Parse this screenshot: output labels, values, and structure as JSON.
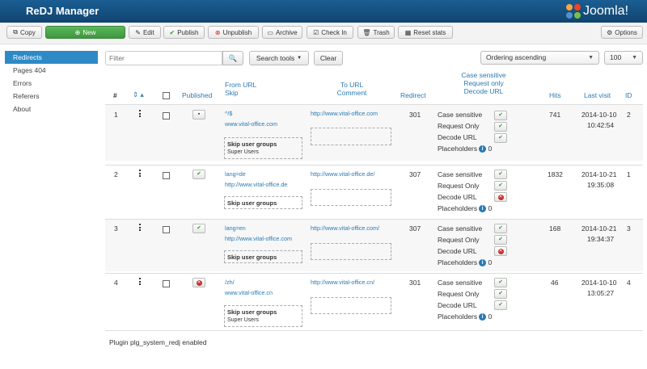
{
  "app": {
    "title": "ReDJ Manager",
    "logo_text": "Joomla!"
  },
  "toolbar": {
    "copy": "Copy",
    "new": "New",
    "edit": "Edit",
    "publish": "Publish",
    "unpublish": "Unpublish",
    "archive": "Archive",
    "check_in": "Check In",
    "trash": "Trash",
    "reset_stats": "Reset stats",
    "options": "Options"
  },
  "sidebar": {
    "items": [
      {
        "label": "Redirects",
        "active": true
      },
      {
        "label": "Pages 404"
      },
      {
        "label": "Errors"
      },
      {
        "label": "Referers"
      },
      {
        "label": "About"
      }
    ]
  },
  "filters": {
    "search_placeholder": "Filter",
    "search_tools": "Search tools",
    "clear": "Clear",
    "ordering": "Ordering ascending",
    "limit": "100"
  },
  "table": {
    "headers": {
      "num": "#",
      "published": "Published",
      "from_url": "From URL",
      "skip": "Skip",
      "to_url": "To URL",
      "comment": "Comment",
      "redirect": "Redirect",
      "flags_1": "Case sensitive",
      "flags_2": "Request only",
      "flags_3": "Decode URL",
      "hits": "Hits",
      "last_visit": "Last visit",
      "id": "ID"
    },
    "flag_labels": {
      "case_sensitive": "Case sensitive",
      "request_only": "Request Only",
      "decode_url": "Decode URL",
      "placeholders": "Placeholders"
    },
    "rows": [
      {
        "num": "1",
        "published": "trash",
        "from": "^/$",
        "skip": "www.vital-office.com",
        "skip_groups_title": "Skip user groups",
        "skip_groups": "Super Users",
        "to": "http://www.vital-office.com",
        "redirect": "301",
        "case": true,
        "request": true,
        "decode": true,
        "placeholders": "0",
        "hits": "741",
        "date": "2014-10-10",
        "time": "10:42:54",
        "id": "2"
      },
      {
        "num": "2",
        "published": "yes",
        "from": "lang=de",
        "skip": "http://www.vital-office.de",
        "skip_groups_title": "Skip user groups",
        "skip_groups": "",
        "to": "http://www.vital-office.de/",
        "redirect": "307",
        "case": true,
        "request": true,
        "decode": false,
        "placeholders": "0",
        "hits": "1832",
        "date": "2014-10-21",
        "time": "19:35:08",
        "id": "1"
      },
      {
        "num": "3",
        "published": "yes",
        "from": "lang=en",
        "skip": "http://www.vital-office.com",
        "skip_groups_title": "Skip user groups",
        "skip_groups": "",
        "to": "http://www.vital-office.com/",
        "redirect": "307",
        "case": true,
        "request": true,
        "decode": false,
        "placeholders": "0",
        "hits": "168",
        "date": "2014-10-21",
        "time": "19:34:37",
        "id": "3"
      },
      {
        "num": "4",
        "published": "no",
        "from": "/zh/",
        "skip": "www.vital-office.cn",
        "skip_groups_title": "Skip user groups",
        "skip_groups": "Super Users",
        "to": "http://www.vital-office.cn/",
        "redirect": "301",
        "case": true,
        "request": true,
        "decode": true,
        "placeholders": "0",
        "hits": "46",
        "date": "2014-10-10",
        "time": "13:05:27",
        "id": "4"
      }
    ]
  },
  "footer": {
    "plugin_status": "Plugin plg_system_redj enabled"
  }
}
